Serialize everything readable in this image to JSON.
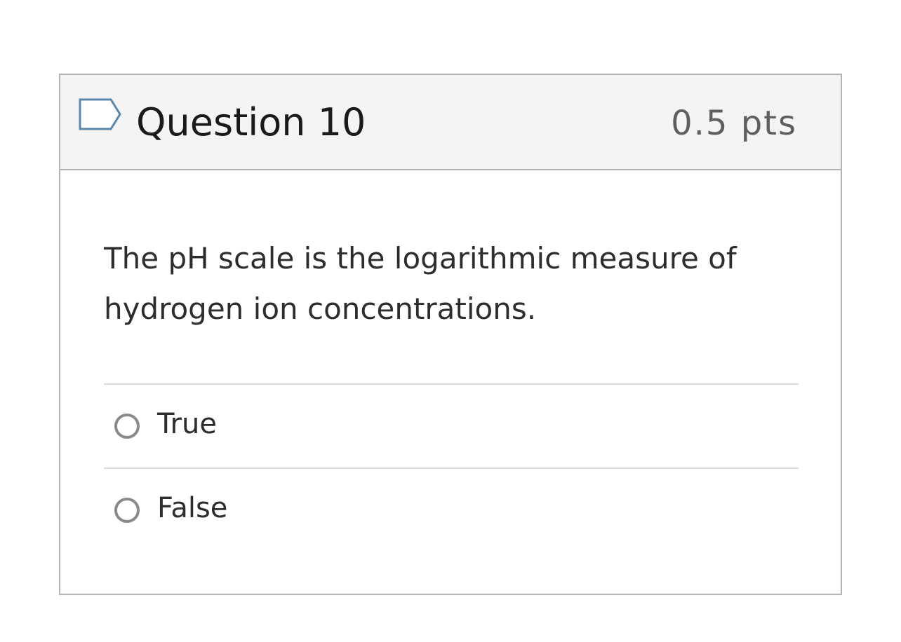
{
  "question": {
    "title": "Question 10",
    "points": "0.5 pts",
    "text": "The pH scale is the logarithmic measure of hydrogen ion concentrations.",
    "flag_icon": "flag-question-icon",
    "answers": [
      {
        "label": "True",
        "selected": false
      },
      {
        "label": "False",
        "selected": false
      }
    ]
  },
  "colors": {
    "header_background": "#f4f4f4",
    "border": "#b3b3b3",
    "flag_outline": "#5b87ac",
    "radio_outline": "#8a8a8a"
  }
}
